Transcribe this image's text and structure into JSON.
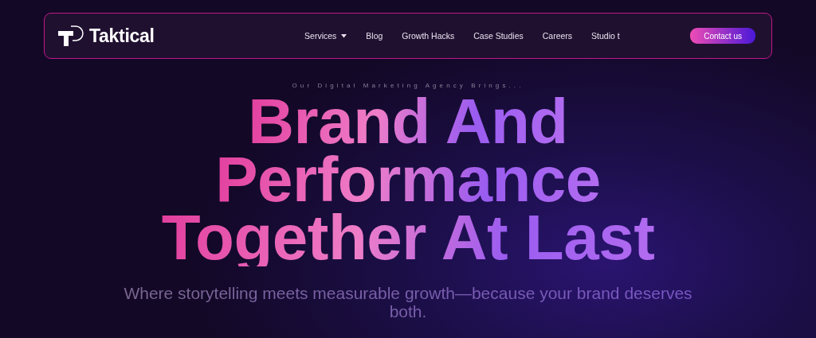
{
  "brand": {
    "name": "Taktical"
  },
  "nav": [
    {
      "label": "Services",
      "has_dropdown": true
    },
    {
      "label": "Blog",
      "has_dropdown": false
    },
    {
      "label": "Growth Hacks",
      "has_dropdown": false
    },
    {
      "label": "Case Studies",
      "has_dropdown": false
    },
    {
      "label": "Careers",
      "has_dropdown": false
    },
    {
      "label": "Studio t",
      "has_dropdown": false
    }
  ],
  "cta": "Contact us",
  "hero": {
    "eyebrow": "Our Digital Marketing Agency Brings...",
    "headline": [
      "Brand And",
      "Performance",
      "Together At Last"
    ],
    "subtitle": "Where storytelling meets measurable growth—because your brand deserves both."
  }
}
